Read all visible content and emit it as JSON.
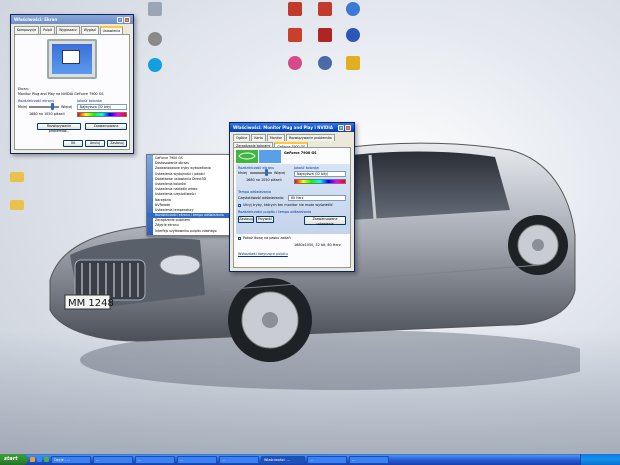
{
  "desktop_icons": [
    {
      "label": "",
      "icon": "trash-icon",
      "color": "#9aa6b6"
    },
    {
      "label": "",
      "icon": "apple-icon",
      "color": "#8a8a8a"
    },
    {
      "label": "",
      "icon": "skype-icon",
      "color": "#14a0e0"
    },
    {
      "label": "",
      "icon": "folder-icon",
      "color": "#e8c24a"
    },
    {
      "label": "",
      "icon": "folder-icon",
      "color": "#e8c24a"
    },
    {
      "label": "",
      "icon": "app-icon",
      "color": "#c23a2c"
    },
    {
      "label": "",
      "icon": "app-icon",
      "color": "#c23a2c"
    },
    {
      "label": "",
      "icon": "app-icon",
      "color": "#3b79d6"
    },
    {
      "label": "",
      "icon": "app-icon",
      "color": "#c8402c"
    },
    {
      "label": "",
      "icon": "app-icon",
      "color": "#b02424"
    },
    {
      "label": "",
      "icon": "app-icon",
      "color": "#2c56b8"
    },
    {
      "label": "",
      "icon": "app-icon",
      "color": "#d64a8a"
    },
    {
      "label": "",
      "icon": "app-icon",
      "color": "#4a6aa8"
    },
    {
      "label": "",
      "icon": "app-icon",
      "color": "#e0b020"
    }
  ],
  "win_small": {
    "title": "Właściwości: Ekran",
    "tabs": [
      "Kompozycje",
      "Pulpit",
      "Wygaszacz",
      "Wygląd",
      "Ustawienia"
    ],
    "display_label": "Ekran:",
    "display_value": "Monitor Plug and Play na NVIDIA GeForce 7900 GS",
    "resolution_label": "Rozdzielczość ekranu",
    "less": "Mniej",
    "more": "Więcej",
    "resolution_value": "1680 na 1050 pikseli",
    "quality_label": "Jakość kolorów",
    "quality_value": "Najwyższa (32 bity)",
    "btn_troubleshoot": "Rozwiązywanie problemów...",
    "btn_advanced": "Zaawansowane",
    "btn_ok": "OK",
    "btn_cancel": "Anuluj",
    "btn_apply": "Zastosuj"
  },
  "context_menu": {
    "items": [
      "GeForce 7900 GS",
      "Dostosowanie obrazu",
      "Zaawansowane tryby wyświetlania",
      "Ustawienia wydajności i jakości",
      "Dodatkowe ustawienia Direct3D",
      "Ustawienia kolorów",
      "Ustawienia nakładki wideo",
      "Ustawienia częstotliwości",
      "Narzędzia",
      "NVRotate",
      "Ustawienia temperatury",
      "Rozdzielczości ekranu i tempo odświeżania",
      "Zarządzanie pulpitem",
      "Zdjęcie ekranu",
      "Interfejs użytkownika pulpitu zdalnego"
    ],
    "highlight_index": 11
  },
  "win_main": {
    "title": "Właściwości: Monitor Plug and Play i NVIDIA GeForce...",
    "tabs": [
      "Ogólne",
      "Karta",
      "Monitor",
      "Rozwiązywanie problemów",
      "Zarządzanie kolorami",
      "GeForce 7900 GS"
    ],
    "panel_title": "GeForce 7900 GS",
    "brand": "NVIDIA",
    "res_label": "Rozdzielczość ekranu",
    "less": "Mniej",
    "more": "Więcej",
    "res_value": "1680 na 1050 pikseli",
    "quality_label": "Jakość kolorów",
    "quality_value": "Najwyższa (32 bity)",
    "refresh_section": "Tempo odświeżania",
    "refresh_label": "Częstotliwość odświeżania:",
    "refresh_value": "60 Herz",
    "hide_modes": "Ukryj tryby, których ten monitor nie może wyświetlić",
    "desktop_section": "Rozdzielczości pulpitu i tempo odświeżania",
    "btn_apply_small": "Zastosuj",
    "btn_restore": "Przywróć",
    "btn_advanced": "Zaawansowane ustawienia",
    "show_icon": "Pokaż ikonę na pasku zadań",
    "current_mode": "1680x1050, 32 bit, 60 Herz",
    "btn_ok": "OK",
    "btn_cancel": "Anuluj",
    "btn_apply": "Zastosuj",
    "help_link": "Wskazówki dotyczące pulpitu"
  },
  "taskbar": {
    "start": "start",
    "items": [
      "Opcje - ...",
      "...",
      "...",
      "...",
      "...",
      "Właściwości: ...",
      "...",
      "..."
    ],
    "tray_time": ""
  }
}
